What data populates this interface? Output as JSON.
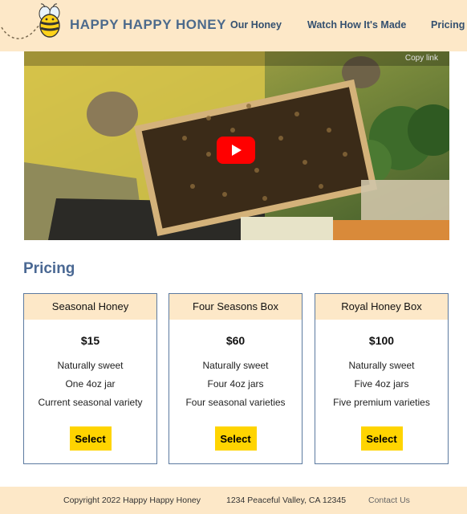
{
  "header": {
    "brand": "HAPPY HAPPY HONEY",
    "nav": [
      "Our Honey",
      "Watch How It's Made",
      "Pricing"
    ]
  },
  "video": {
    "copy_link": "Copy link"
  },
  "pricing": {
    "title": "Pricing",
    "plans": [
      {
        "name": "Seasonal Honey",
        "price": "$15",
        "features": [
          "Naturally sweet",
          "One 4oz jar",
          "Current seasonal variety"
        ],
        "button": "Select"
      },
      {
        "name": "Four Seasons Box",
        "price": "$60",
        "features": [
          "Naturally sweet",
          "Four 4oz jars",
          "Four seasonal varieties"
        ],
        "button": "Select"
      },
      {
        "name": "Royal Honey Box",
        "price": "$100",
        "features": [
          "Naturally sweet",
          "Five 4oz jars",
          "Five premium varieties"
        ],
        "button": "Select"
      }
    ]
  },
  "footer": {
    "copyright": "Copyright 2022 Happy Happy Honey",
    "address": "1234 Peaceful Valley, CA 12345",
    "contact": "Contact Us"
  },
  "colors": {
    "header_bg": "#fde8c8",
    "brand_blue": "#4c6a8c",
    "button_yellow": "#ffd400",
    "card_border": "#5c7aa0",
    "youtube_red": "#ff0000"
  },
  "icons": [
    "bee-logo-icon",
    "play-icon"
  ]
}
